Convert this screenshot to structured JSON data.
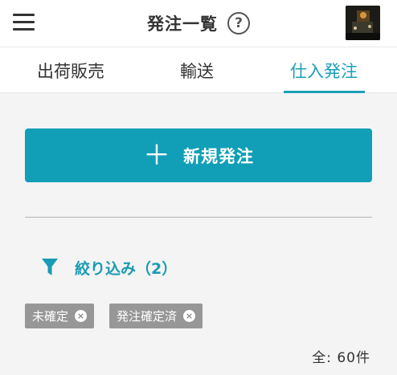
{
  "header": {
    "title": "発注一覧",
    "help_glyph": "?",
    "menu_icon": "hamburger-menu-icon",
    "help_icon": "question-circle-icon"
  },
  "tabs": [
    {
      "label": "出荷販売",
      "active": false
    },
    {
      "label": "輸送",
      "active": false
    },
    {
      "label": "仕入発注",
      "active": true
    }
  ],
  "actions": {
    "new_order_label": "新規発注",
    "plus_glyph": "＋"
  },
  "filter": {
    "label": "絞り込み（2）",
    "icon": "funnel-filter-icon",
    "chips": [
      {
        "label": "未確定"
      },
      {
        "label": "発注確定済"
      }
    ],
    "chip_close_glyph": "×"
  },
  "summary": {
    "total_label": "全: 60件"
  },
  "colors": {
    "accent": "#1ba0b8",
    "button": "#119fb7",
    "chip": "#979797",
    "background": "#f4f4f4"
  }
}
